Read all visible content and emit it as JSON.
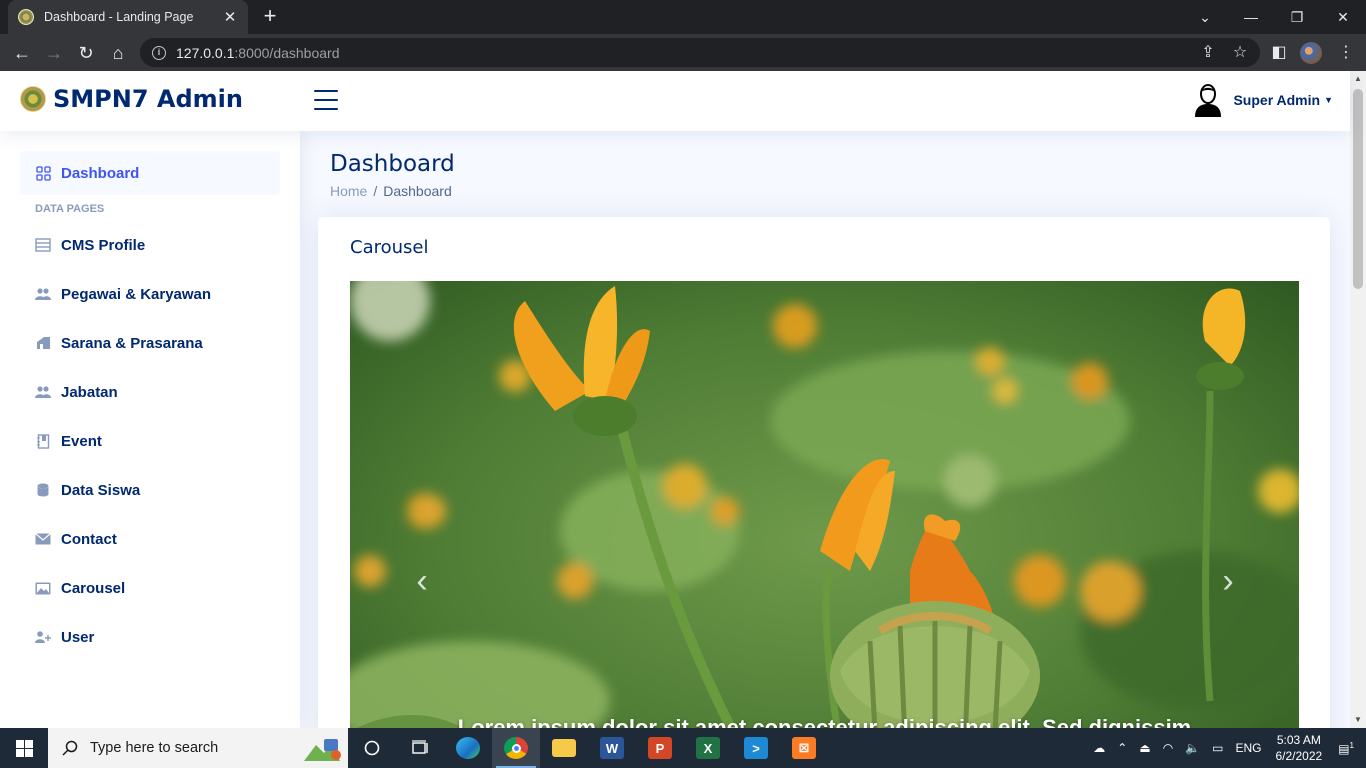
{
  "browser": {
    "tab_title": "Dashboard - Landing Page",
    "url_host": "127.0.0.1",
    "url_path": ":8000/dashboard"
  },
  "header": {
    "brand": "SMPN7 Admin",
    "user_name": "Super Admin"
  },
  "sidebar": {
    "dashboard_label": "Dashboard",
    "section_heading": "DATA PAGES",
    "items": [
      {
        "label": "CMS Profile",
        "icon": "layout-icon"
      },
      {
        "label": "Pegawai & Karyawan",
        "icon": "people-icon"
      },
      {
        "label": "Sarana & Prasarana",
        "icon": "building-icon"
      },
      {
        "label": "Jabatan",
        "icon": "people-icon"
      },
      {
        "label": "Event",
        "icon": "journal-icon"
      },
      {
        "label": "Data Siswa",
        "icon": "database-icon"
      },
      {
        "label": "Contact",
        "icon": "envelope-icon"
      },
      {
        "label": "Carousel",
        "icon": "image-icon"
      },
      {
        "label": "User",
        "icon": "person-plus-icon"
      }
    ]
  },
  "page": {
    "title": "Dashboard",
    "breadcrumb_home": "Home",
    "breadcrumb_current": "Dashboard",
    "card_title": "Carousel"
  },
  "carousel": {
    "caption": "Lorem ipsum dolor sit amet consectetur adipiscing elit. Sed dignissim"
  },
  "taskbar": {
    "search_placeholder": "Type here to search",
    "language": "ENG",
    "time": "5:03 AM",
    "date": "6/2/2022",
    "notification_count": "1"
  },
  "colors": {
    "brand": "#012970",
    "accent": "#4154f1",
    "muted": "#899bbd"
  }
}
